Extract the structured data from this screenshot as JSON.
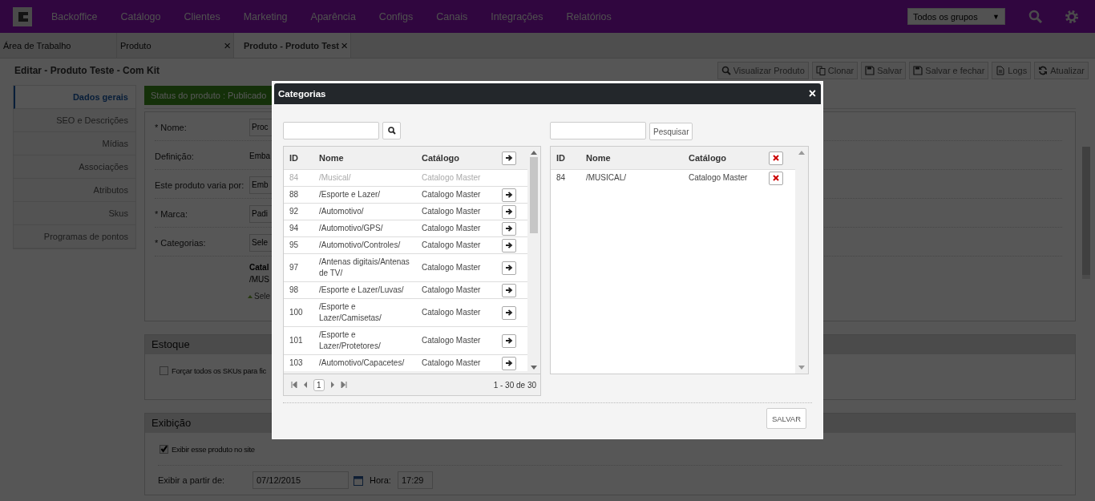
{
  "nav": {
    "menu": [
      "Backoffice",
      "Catálogo",
      "Clientes",
      "Marketing",
      "Aparência",
      "Configs",
      "Canais",
      "Integrações",
      "Relatórios"
    ],
    "group_select": "Todos os grupos",
    "group_caret": "▼"
  },
  "tabs": [
    {
      "label": "Área de Trabalho",
      "selected": false
    },
    {
      "label": "Produto",
      "selected": false,
      "close": "×"
    },
    {
      "label": "Produto - Produto Test",
      "selected": true,
      "close": "×"
    }
  ],
  "page": {
    "title": "Editar - Produto Teste - Com Kit",
    "toolbar": [
      {
        "label": "Visualizar Produto",
        "kind": "view"
      },
      {
        "label": "Clonar",
        "kind": "clone"
      },
      {
        "label": "Salvar",
        "kind": "save"
      },
      {
        "label": "Salvar e fechar",
        "kind": "save"
      },
      {
        "label": "Logs",
        "kind": "log"
      },
      {
        "label": "Atualizar",
        "kind": "refresh"
      }
    ]
  },
  "sidebar": [
    {
      "label": "Dados gerais",
      "selected": true
    },
    {
      "label": "SEO e Descrições",
      "selected": false
    },
    {
      "label": "Mídias",
      "selected": false
    },
    {
      "label": "Associações",
      "selected": false
    },
    {
      "label": "Atributos",
      "selected": false
    },
    {
      "label": "Skus",
      "selected": false
    },
    {
      "label": "Programas de pontos",
      "selected": false
    }
  ],
  "status": "Status do produto : Publicado",
  "form": [
    {
      "label": "* Nome:",
      "kind": "input",
      "value": "Proc"
    },
    {
      "label": "Definição:",
      "kind": "text",
      "value": "Emba"
    },
    {
      "label": "Este produto varia por:",
      "kind": "input",
      "value": "Emb"
    },
    {
      "label": "* Marca:",
      "kind": "input",
      "value": "Padi"
    },
    {
      "label": "* Categorias:",
      "kind": "input",
      "value": "Sele"
    }
  ],
  "category_note": {
    "heading": "Catal",
    "path": "/MUS",
    "hint": "Sele"
  },
  "estoque": {
    "title": "Estoque",
    "checkbox": {
      "label": "Forçar todos os SKUs para fic",
      "checked": false
    }
  },
  "exibicao": {
    "title": "Exibição",
    "checkbox": {
      "label": "Exibir esse produto no site",
      "checked": true
    },
    "date_label": "Exibir a partir de:",
    "date": "07/12/2015",
    "time_label": "Hora:",
    "time": "17:29"
  },
  "modal": {
    "title": "Categorias",
    "close": "×",
    "left": {
      "columns": [
        "ID",
        "Nome",
        "Catálogo"
      ],
      "rows": [
        {
          "id": "84",
          "name": "/Musical/",
          "catalog": "Catalogo Master",
          "disabled": true
        },
        {
          "id": "88",
          "name": "/Esporte e Lazer/",
          "catalog": "Catalogo Master",
          "disabled": false
        },
        {
          "id": "92",
          "name": "/Automotivo/",
          "catalog": "Catalogo Master",
          "disabled": false
        },
        {
          "id": "94",
          "name": "/Automotivo/GPS/",
          "catalog": "Catalogo Master",
          "disabled": false
        },
        {
          "id": "95",
          "name": "/Automotivo/Controles/",
          "catalog": "Catalogo Master",
          "disabled": false
        },
        {
          "id": "97",
          "name": "/Antenas digitais/Antenas de TV/",
          "catalog": "Catalogo Master",
          "disabled": false
        },
        {
          "id": "98",
          "name": "/Esporte e Lazer/Luvas/",
          "catalog": "Catalogo Master",
          "disabled": false
        },
        {
          "id": "100",
          "name": "/Esporte e Lazer/Camisetas/",
          "catalog": "Catalogo Master",
          "disabled": false
        },
        {
          "id": "101",
          "name": "/Esporte e Lazer/Protetores/",
          "catalog": "Catalogo Master",
          "disabled": false
        },
        {
          "id": "103",
          "name": "/Automotivo/Capacetes/",
          "catalog": "Catalogo Master",
          "disabled": false
        }
      ],
      "page": "1",
      "summary": "1 - 30 de 30"
    },
    "right": {
      "search_button": "Pesquisar",
      "columns": [
        "ID",
        "Nome",
        "Catálogo"
      ],
      "rows": [
        {
          "id": "84",
          "name": "/MUSICAL/",
          "catalog": "Catalogo Master"
        }
      ]
    },
    "save": "SALVAR"
  }
}
